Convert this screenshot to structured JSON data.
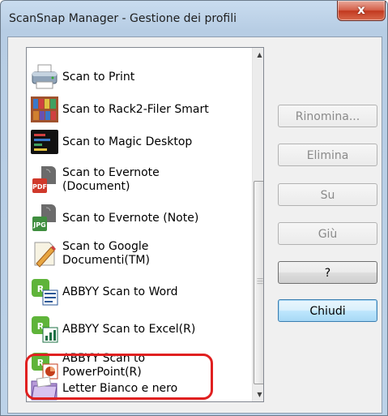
{
  "window": {
    "title": "ScanSnap Manager - Gestione dei profili",
    "close_label": "x"
  },
  "profiles": [
    {
      "label": "Scan to Print",
      "icon": "printer-icon"
    },
    {
      "label": "Scan to Rack2-Filer Smart",
      "icon": "rack2-filer-icon"
    },
    {
      "label": "Scan to Magic Desktop",
      "icon": "magic-desktop-icon"
    },
    {
      "label": "Scan to Evernote\n(Document)",
      "icon": "evernote-pdf-icon"
    },
    {
      "label": "Scan to Evernote (Note)",
      "icon": "evernote-jpg-icon"
    },
    {
      "label": "Scan to Google\nDocumenti(TM)",
      "icon": "google-docs-icon"
    },
    {
      "label": "ABBYY Scan to Word",
      "icon": "abbyy-word-icon"
    },
    {
      "label": "ABBYY Scan to Excel(R)",
      "icon": "abbyy-excel-icon"
    },
    {
      "label": "ABBYY Scan to\nPowerPoint(R)",
      "icon": "abbyy-powerpoint-icon"
    },
    {
      "label": "Letter Bianco e nero",
      "icon": "folder-icon"
    }
  ],
  "buttons": {
    "rinomina": "Rinomina...",
    "elimina": "Elimina",
    "su": "Su",
    "giu": "Giù",
    "help": "?",
    "chiudi": "Chiudi"
  },
  "highlight_color": "#e02020"
}
